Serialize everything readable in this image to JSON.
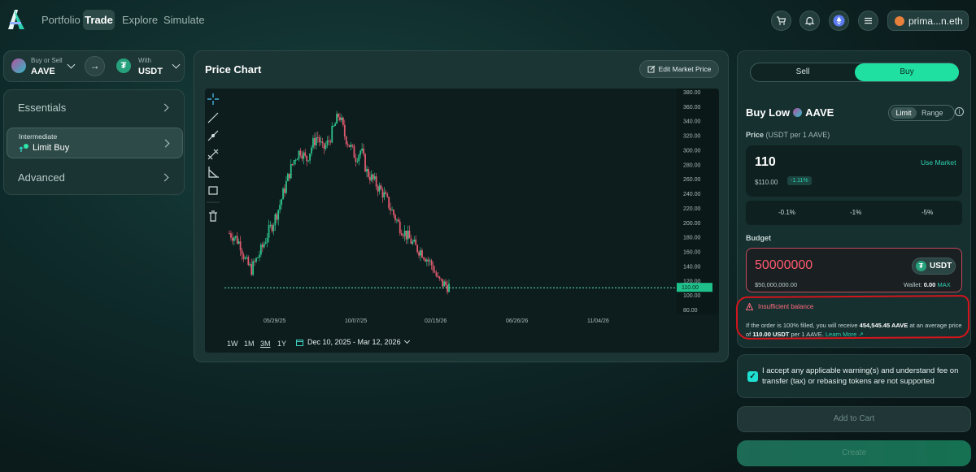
{
  "nav": {
    "links": [
      "Portfolio",
      "Trade",
      "Explore",
      "Simulate"
    ],
    "wallet": "prima...n.eth",
    "icons": [
      "cart-icon",
      "bell-icon",
      "ethereum-icon",
      "menu-icon"
    ]
  },
  "selector": {
    "left_small": "Buy or Sell",
    "left_token": "AAVE",
    "right_small": "With",
    "right_token": "USDT"
  },
  "strategies": {
    "essentials": "Essentials",
    "intermediate_small": "Intermediate",
    "intermediate_label": "Limit Buy",
    "advanced": "Advanced"
  },
  "chart": {
    "title": "Price Chart",
    "edit_button": "Edit Market Price",
    "ranges": [
      "1W",
      "1M",
      "3M",
      "1Y"
    ],
    "active_range": "3M",
    "date_range": "Dec 10, 2025 - Mar 12, 2026",
    "current_price_label": "110.00"
  },
  "chart_data": {
    "type": "candlestick",
    "x_ticks": [
      "05/29/25",
      "10/07/25",
      "02/15/26",
      "06/26/26",
      "11/04/26"
    ],
    "y_ticks": [
      "80.00",
      "100.00",
      "120.00",
      "140.00",
      "160.00",
      "180.00",
      "200.00",
      "220.00",
      "240.00",
      "260.00",
      "280.00",
      "300.00",
      "320.00",
      "340.00",
      "360.00",
      "380.00"
    ],
    "ylim": [
      80,
      380
    ],
    "limit_price": 110,
    "series_close": [
      185,
      180,
      170,
      145,
      135,
      150,
      165,
      185,
      200,
      220,
      245,
      270,
      290,
      300,
      285,
      305,
      320,
      300,
      310,
      330,
      350,
      320,
      305,
      290,
      300,
      270,
      260,
      250,
      240,
      225,
      210,
      195,
      185,
      175,
      165,
      160,
      150,
      140,
      120,
      115,
      112
    ]
  },
  "order": {
    "sell": "Sell",
    "buy": "Buy",
    "buy_low_prefix": "Buy Low",
    "token": "AAVE",
    "mode_limit": "Limit",
    "mode_range": "Range",
    "price_label": "Price",
    "price_unit": "(USDT per 1 AAVE)",
    "price_value": "110",
    "use_market": "Use Market",
    "price_usd": "$110.00",
    "price_change": "-1.11%",
    "pct_options": [
      "-0.1%",
      "-1%",
      "-5%"
    ],
    "budget_label": "Budget",
    "budget_value": "50000000",
    "budget_token": "USDT",
    "budget_usd": "$50,000,000.00",
    "wallet_label": "Wallet:",
    "wallet_value": "0.00",
    "max": "MAX",
    "warning": "Insufficient balance",
    "fill_info_1": "If the order is 100% filled, you will receive",
    "fill_info_amount": "454,545.45 AAVE",
    "fill_info_2": "at an average price of",
    "fill_info_price": "110.00 USDT",
    "fill_info_3": "per 1 AAVE.",
    "learn_more": "Learn More"
  },
  "accept_text": "I accept any applicable warning(s) and understand fee on transfer (tax) or rebasing tokens are not supported",
  "buttons": {
    "cart": "Add to Cart",
    "create": "Create"
  },
  "colors": {
    "accent": "#1fe0a0",
    "danger": "#e0455a",
    "up": "#2ec089",
    "down": "#e05a6e"
  }
}
